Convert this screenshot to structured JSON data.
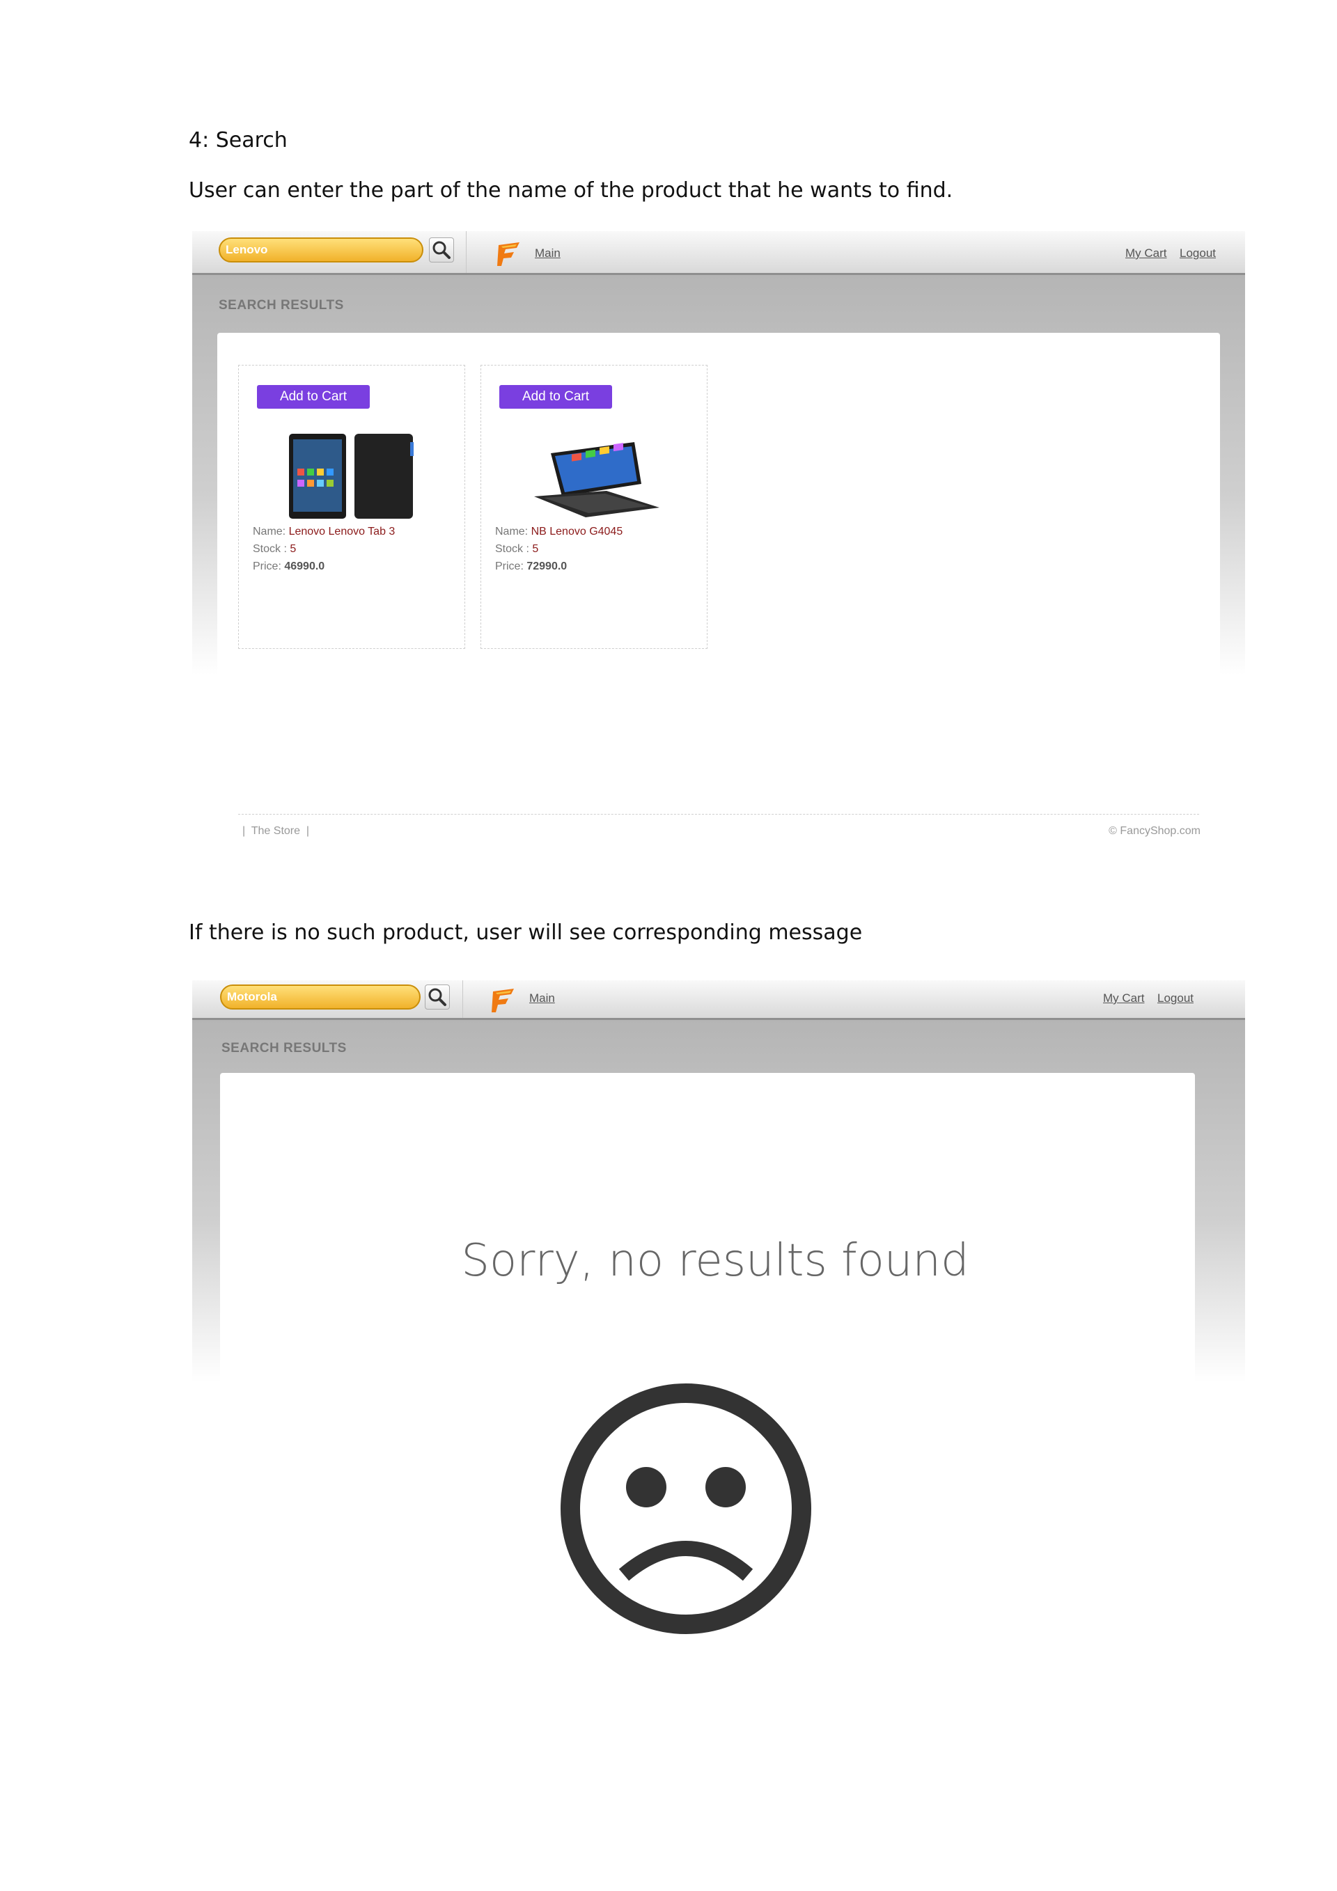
{
  "doc": {
    "heading": "4: Search",
    "intro": "User can enter the part of the name of the product that he wants to find.",
    "no_result_note": "If there is no such product, user will see corresponding message"
  },
  "shot1": {
    "search_value": "Lenovo",
    "nav_main": "Main",
    "my_cart": "My Cart",
    "logout": "Logout",
    "results_title": "SEARCH RESULTS",
    "products": [
      {
        "add_label": "Add to Cart",
        "name_label": "Name:",
        "name": "Lenovo Lenovo Tab 3",
        "stock_label": "Stock :",
        "stock": "5",
        "price_label": "Price:",
        "price": "46990.0",
        "image": "tablet-image"
      },
      {
        "add_label": "Add to Cart",
        "name_label": "Name:",
        "name": "NB Lenovo G4045",
        "stock_label": "Stock :",
        "stock": "5",
        "price_label": "Price:",
        "price": "72990.0",
        "image": "laptop-image"
      }
    ],
    "footer_left": "|  The Store  |",
    "footer_right": "© FancyShop.com"
  },
  "shot2": {
    "search_value": "Motorola",
    "nav_main": "Main",
    "my_cart": "My Cart",
    "logout": "Logout",
    "results_title": "SEARCH RESULTS",
    "message": "Sorry, no results found",
    "icon": "sad-face-icon"
  },
  "colors": {
    "accent_button": "#7a3fe0",
    "search_field": "#f1b22b",
    "value_text": "#8b1a1a"
  }
}
